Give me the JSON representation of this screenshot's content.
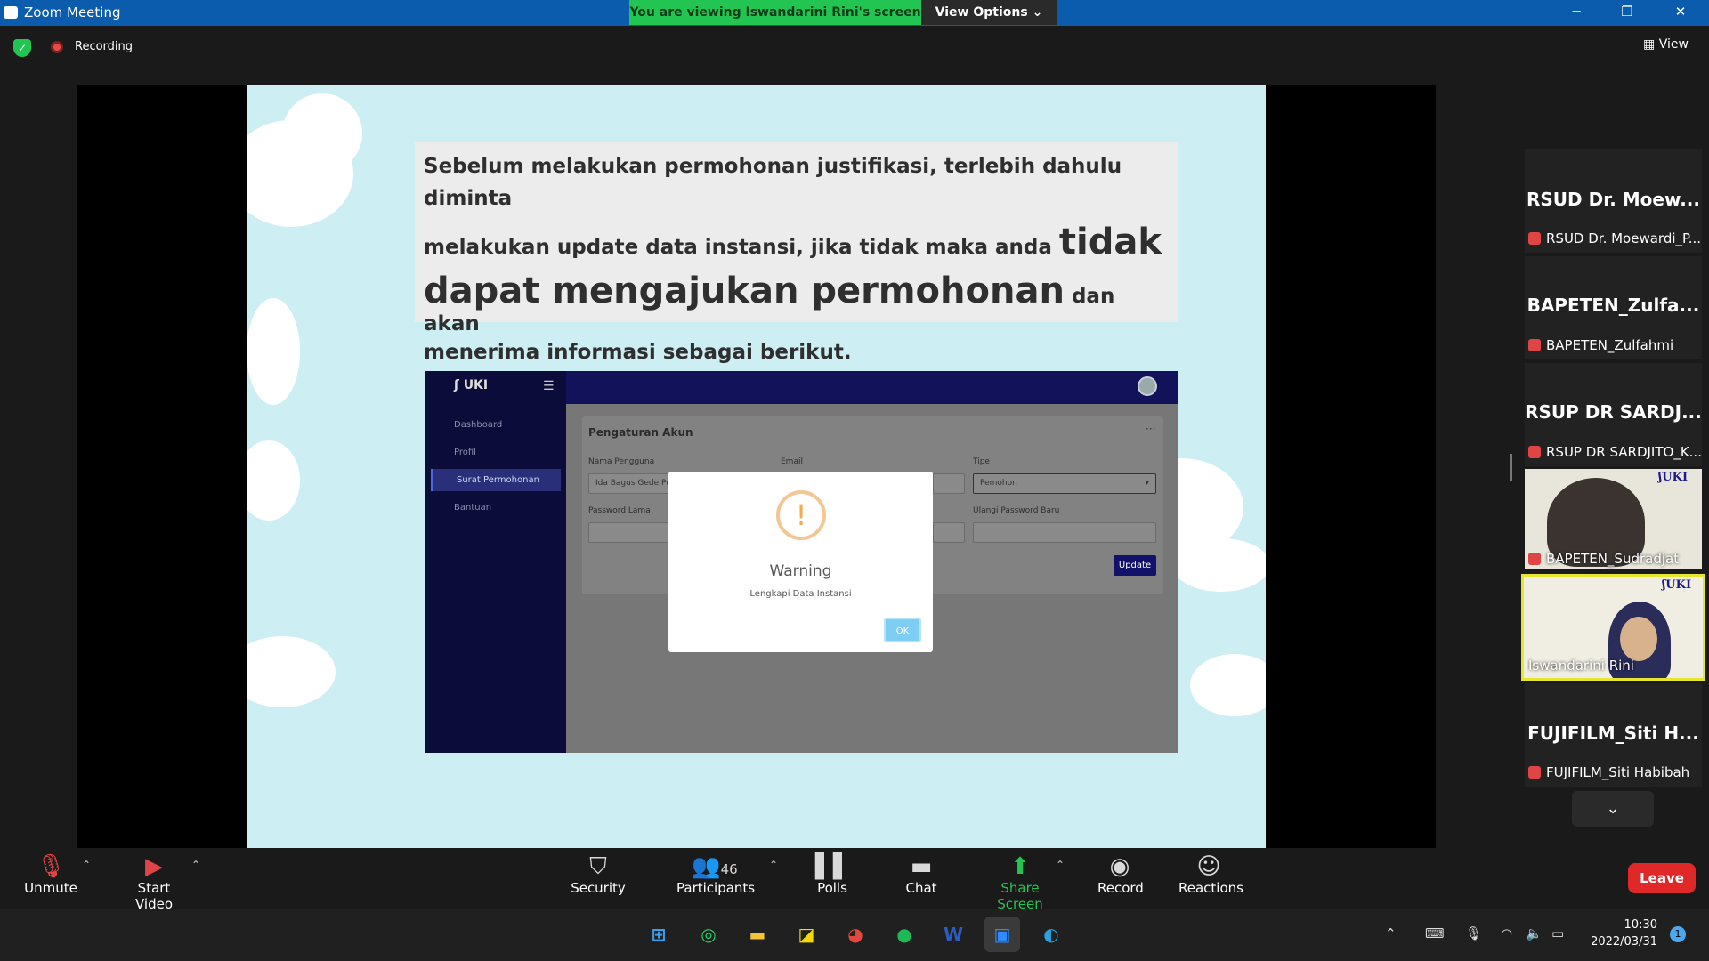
{
  "window": {
    "title": "Zoom Meeting"
  },
  "banner": {
    "viewing_text": "You are viewing Iswandarini Rini's screen",
    "view_options": "View Options ⌄"
  },
  "topbar": {
    "recording": "Recording",
    "view": "View"
  },
  "slide": {
    "line1": "Sebelum melakukan permohonan justifikasi, terlebih dahulu diminta",
    "line2_a": "melakukan update data instansi, jika tidak maka anda ",
    "line2_b": "tidak",
    "line3_a": "dapat mengajukan permohonan",
    "line3_b": " dan akan",
    "line4": "menerima informasi sebagai berikut."
  },
  "app": {
    "logo": "UKI",
    "nav": [
      "Dashboard",
      "Profil",
      "Surat Permohonan",
      "Bantuan"
    ],
    "card_title": "Pengaturan Akun",
    "labels": {
      "username": "Nama Pengguna",
      "email": "Email",
      "type": "Tipe",
      "old_password": "Password Lama",
      "repeat_password": "Ulangi Password Baru"
    },
    "values": {
      "username": "Ida Bagus Gede Putra",
      "type": "Pemohon"
    },
    "update": "Update",
    "modal": {
      "icon": "!",
      "title": "Warning",
      "message": "Lengkapi Data Instansi",
      "ok": "OK"
    }
  },
  "participants": [
    {
      "big": "RSUD Dr. Moew...",
      "name": "RSUD Dr. Moewardi_P..."
    },
    {
      "big": "BAPETEN_Zulfa...",
      "name": "BAPETEN_Zulfahmi"
    },
    {
      "big": "RSUP DR SARDJ...",
      "name": "RSUP DR SARDJITO_K..."
    },
    {
      "name": "BAPETEN_Sudradjat"
    },
    {
      "name": "Iswandarini Rini"
    },
    {
      "big": "FUJIFILM_Siti H...",
      "name": "FUJIFILM_Siti Habibah"
    }
  ],
  "toolbar": {
    "unmute": "Unmute",
    "start_video": "Start Video",
    "security": "Security",
    "participants": "Participants",
    "participants_count": "46",
    "polls": "Polls",
    "chat": "Chat",
    "share_screen": "Share Screen",
    "record": "Record",
    "reactions": "Reactions",
    "leave": "Leave"
  },
  "taskbar": {
    "time": "10:30",
    "date": "2022/03/31",
    "notif": "1"
  },
  "colors": {
    "zoom_blue": "#0b5cad",
    "share_green": "#23c552",
    "leave_red": "#e02828",
    "slide_bg": "#cdeef2"
  }
}
